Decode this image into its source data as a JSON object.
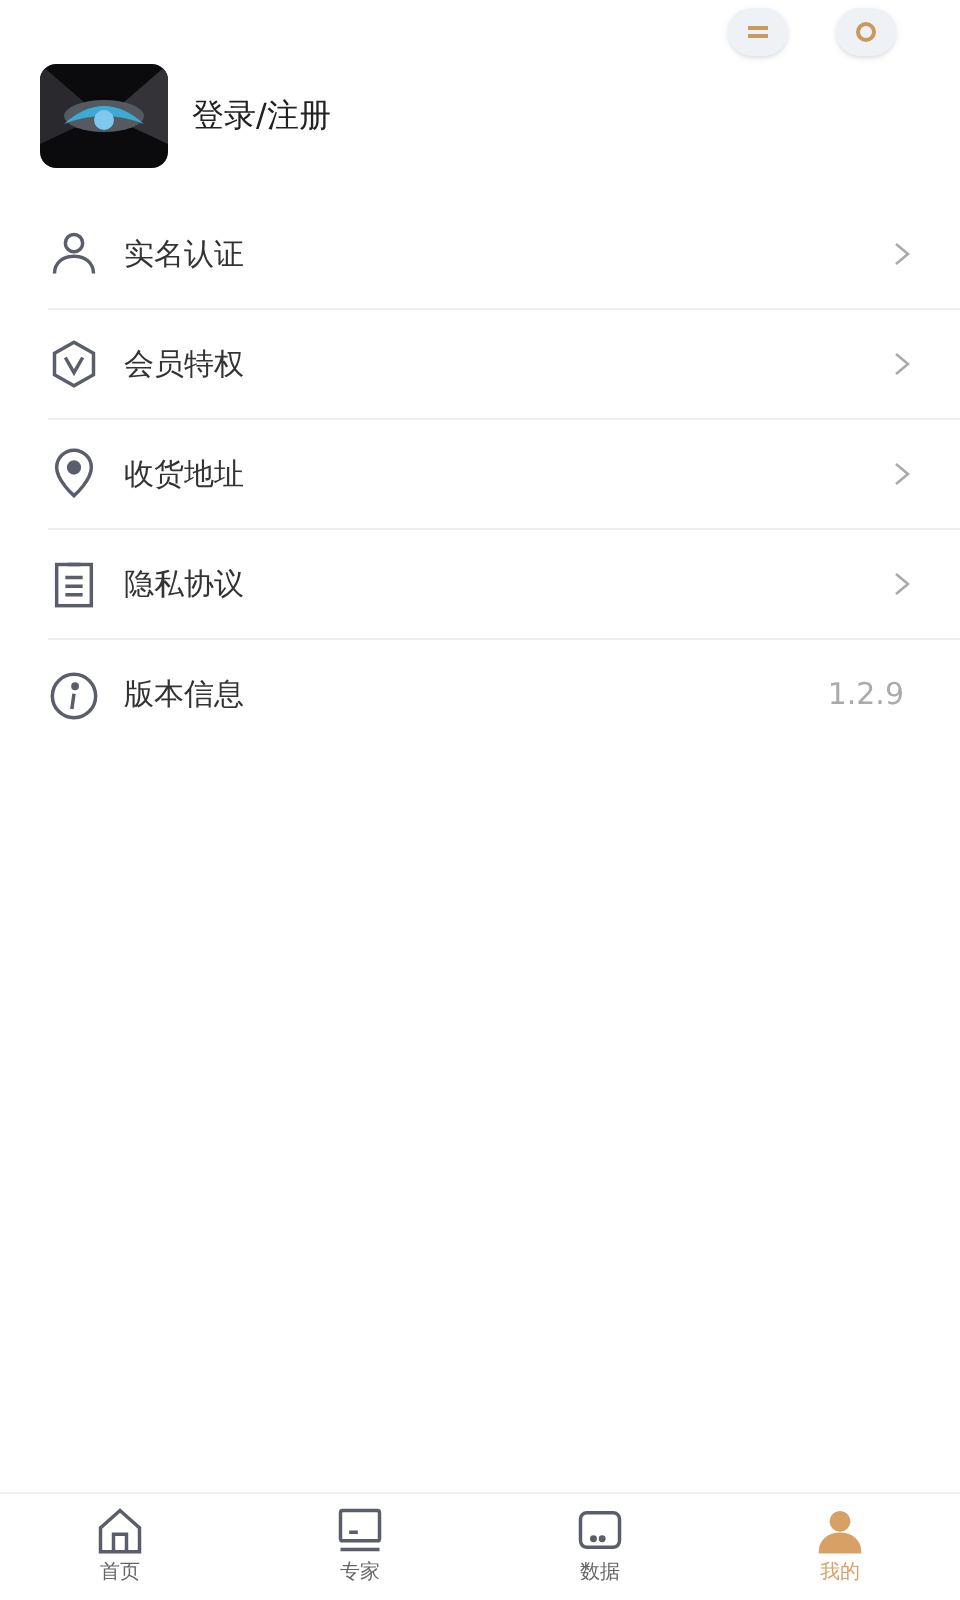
{
  "profile": {
    "login_label": "登录/注册"
  },
  "menu": [
    {
      "kind": "person",
      "label": "实名认证"
    },
    {
      "kind": "vip",
      "label": "会员特权"
    },
    {
      "kind": "location",
      "label": "收货地址"
    },
    {
      "kind": "document",
      "label": "隐私协议"
    },
    {
      "kind": "info",
      "label": "版本信息",
      "value": "1.2.9"
    }
  ],
  "tab_bar": [
    {
      "kind": "home",
      "label": "首页",
      "selected": false
    },
    {
      "kind": "expert",
      "label": "专家",
      "selected": false
    },
    {
      "kind": "data",
      "label": "数据",
      "selected": false
    },
    {
      "kind": "me",
      "label": "我的",
      "selected": true
    }
  ]
}
